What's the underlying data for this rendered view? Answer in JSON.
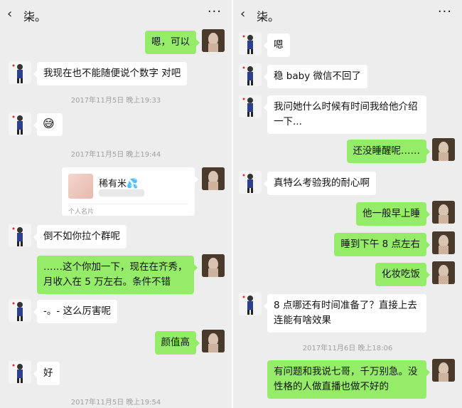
{
  "left": {
    "header": {
      "back_icon": "‹",
      "title": "柒。",
      "more_icon": "···"
    },
    "messages": [
      {
        "from": "me",
        "text": "嗯，可以"
      },
      {
        "from": "other",
        "text": "我现在也不能随便说个数字 对吧"
      },
      {
        "timestamp": "2017年11月5日 晚上19:33"
      },
      {
        "from": "other",
        "emoji": "😅"
      },
      {
        "timestamp": "2017年11月5日 晚上19:44"
      },
      {
        "from": "me",
        "card": {
          "name": "稀有米💦",
          "label": "个人名片"
        }
      },
      {
        "from": "other",
        "text": "倒不如你拉个群呢"
      },
      {
        "from": "me",
        "text": "……这个你加一下，现在在齐秀，月收入在 5 万左右。条件不错"
      },
      {
        "from": "other",
        "text": "-。- 这么厉害呢"
      },
      {
        "from": "me",
        "text": "颜值高"
      },
      {
        "from": "other",
        "text": "好"
      },
      {
        "timestamp": "2017年11月5日 晚上19:54"
      }
    ]
  },
  "right": {
    "header": {
      "back_icon": "‹",
      "title": "柒。",
      "more_icon": "···"
    },
    "messages": [
      {
        "from": "other",
        "text": "嗯"
      },
      {
        "from": "other",
        "text": "稳 baby 微信不回了"
      },
      {
        "from": "other",
        "text": "我问她什么时候有时间我给他介绍一下..."
      },
      {
        "from": "me",
        "text": "还没睡醒呢……"
      },
      {
        "from": "other",
        "text": "真特么考验我的耐心啊"
      },
      {
        "from": "me",
        "text": "他一般早上睡"
      },
      {
        "from": "me",
        "text": "睡到下午 8 点左右"
      },
      {
        "from": "me",
        "text": "化妆吃饭"
      },
      {
        "from": "other",
        "text": "8 点哪还有时间准备了？直接上去连能有啥效果"
      },
      {
        "timestamp": "2017年11月6日 晚上18:06"
      },
      {
        "from": "me",
        "text": "有问题和我说七哥，千万别急。没性格的人做直播也做不好的"
      }
    ]
  }
}
